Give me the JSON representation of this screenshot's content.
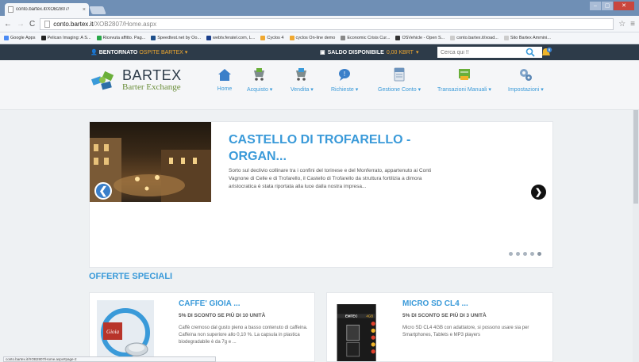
{
  "browser": {
    "tab_title": "conto.bartex.it/XOB2807/",
    "tab_close": "×",
    "url_host": "conto.bartex.it",
    "url_path": "/XOB2807/Home.aspx",
    "bookmarks": [
      {
        "label": "Google Apps",
        "color": "#4a8af4"
      },
      {
        "label": "Pelican Imaging: A S...",
        "color": "#222222"
      },
      {
        "label": "Ricevuta affitto. Pag...",
        "color": "#2aa84a"
      },
      {
        "label": "Speedtest.net by Oo...",
        "color": "#1e4f8a"
      },
      {
        "label": "webtv.feratel.com, L...",
        "color": "#1b3f8c"
      },
      {
        "label": "Cyclos 4",
        "color": "#f0a830"
      },
      {
        "label": "cyclos On-line demo",
        "color": "#f0a830"
      },
      {
        "label": "Economic Crisis Cur...",
        "color": "#888888"
      },
      {
        "label": "OSVehicle - Open S...",
        "color": "#333333"
      },
      {
        "label": "conto.bartex.it/xoad...",
        "color": "#cccccc"
      },
      {
        "label": "Sito Bartex Ammini...",
        "color": "#cccccc"
      }
    ],
    "status_text": "conto.bartex.it/XOB2807/Home.aspx#page-2"
  },
  "topbar": {
    "welcome_label": "BENTORNATO",
    "guest_label": "OSPITE BARTEX",
    "balance_label": "SALDO DISPONIBILE",
    "balance_amount": "0,00 KBRT",
    "search_placeholder": "Cerca qui !!",
    "notification_count": "0"
  },
  "header": {
    "logo_title": "BARTEX",
    "logo_subtitle": "Barter Exchange",
    "nav": [
      {
        "label": "Home"
      },
      {
        "label": "Acquisto ▾"
      },
      {
        "label": "Vendita ▾"
      },
      {
        "label": "Richieste ▾"
      },
      {
        "label": "Gestione Conto ▾"
      },
      {
        "label": "Transazioni Manuali ▾"
      },
      {
        "label": "Impostazioni ▾"
      }
    ]
  },
  "slider": {
    "title": "CASTELLO DI TROFARELLO - ORGAN...",
    "description": "Sorto sul declivio collinare tra i confini del torinese e del Monferrato, appartenuto ai Conti Vagnone di Celle e di Trofarello, il Castello di Trofarello da struttura fortilizia a dimora aristocratica è stata riportata alla luce dalla nostra impresa...",
    "prev": "❮",
    "next": "❯",
    "dot_count": 5
  },
  "offers": {
    "section_title": "OFFERTE SPECIALI",
    "items": [
      {
        "title": "CAFFE' GIOIA ...",
        "subtitle": "5% DI SCONTO SE PIÙ DI 10 UNITÀ",
        "description": "Caffè cremoso dal gusto pieno a basso contenuto di caffeina. Caffeina non superiore allo 0,10 %. La capsula in plastica biodegradabile è da 7g e ..."
      },
      {
        "title": "MICRO SD CL4 ...",
        "subtitle": "5% DI SCONTO SE PIÙ DI 3 UNITÀ",
        "description": "Micro SD CL4 4GB con adattatore, si possono usare sia per Smartphones, Tablets e MP3 players"
      }
    ]
  },
  "colors": {
    "accent": "#3a9ad9",
    "topbar": "#2d3b49",
    "highlight": "#f0a830"
  }
}
